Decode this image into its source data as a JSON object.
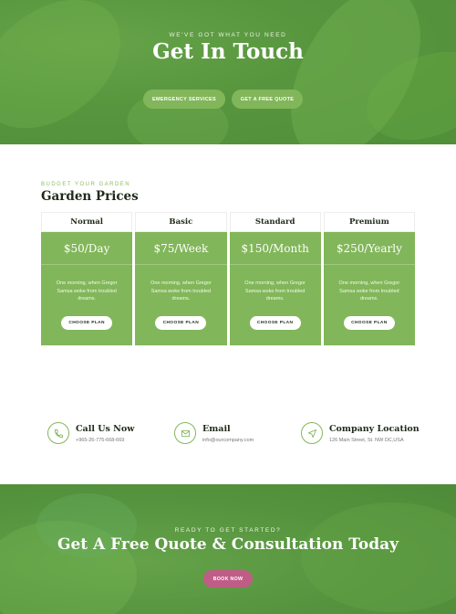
{
  "hero": {
    "eyebrow": "WE'VE GOT WHAT YOU NEED",
    "title": "Get In Touch",
    "buttons": {
      "emergency": "EMERGENCY SERVICES",
      "quote": "GET A FREE QUOTE"
    }
  },
  "pricing": {
    "eyebrow": "BUDGET YOUR GARDEN",
    "title": "Garden Prices",
    "plans": [
      {
        "name": "Normal",
        "price": "$50/Day",
        "description": "One morning, when Gregor Samsa woke from troubled dreams.",
        "button": "CHOOSE PLAN"
      },
      {
        "name": "Basic",
        "price": "$75/Week",
        "description": "One morning, when Gregor Samsa woke from troubled dreams.",
        "button": "CHOOSE PLAN"
      },
      {
        "name": "Standard",
        "price": "$150/Month",
        "description": "One morning, when Gregor Samsa woke from troubled dreams.",
        "button": "CHOOSE PLAN"
      },
      {
        "name": "Premium",
        "price": "$250/Yearly",
        "description": "One morning, when Gregor Samsa woke from troubled dreams.",
        "button": "CHOOSE PLAN"
      }
    ]
  },
  "contact": [
    {
      "icon": "phone-icon",
      "title": "Call Us Now",
      "detail": "+965-26-775-668-669"
    },
    {
      "icon": "mail-icon",
      "title": "Email",
      "detail": "info@ourcompany.com"
    },
    {
      "icon": "location-arrow-icon",
      "title": "Company Location",
      "detail": "126 Main Street, St. NW DC,USA"
    }
  ],
  "cta": {
    "eyebrow": "READY TO GET STARTED?",
    "title": "Get A Free Quote & Consultation Today",
    "button": "BOOK NOW"
  },
  "colors": {
    "accent": "#82b65a",
    "book_button": "#c05d87",
    "heading": "#1f2a1a"
  }
}
